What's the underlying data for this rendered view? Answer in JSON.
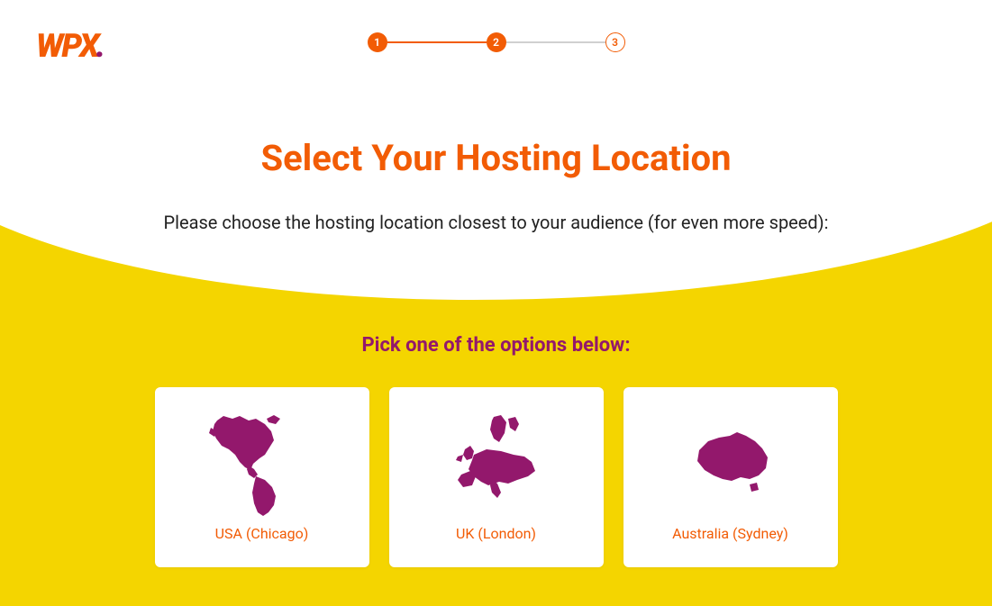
{
  "logo": {
    "text": "WPX",
    "dot": "."
  },
  "stepper": {
    "steps": [
      "1",
      "2",
      "3"
    ],
    "current": 2
  },
  "hero": {
    "title": "Select Your Hosting Location",
    "subtitle": "Please choose the hosting location closest to your audience (for even more speed):"
  },
  "options": {
    "title": "Pick one of the options below:",
    "items": [
      {
        "label": "USA (Chicago)",
        "icon": "americas-map-icon"
      },
      {
        "label": "UK (London)",
        "icon": "europe-map-icon"
      },
      {
        "label": "Australia (Sydney)",
        "icon": "australia-map-icon"
      }
    ]
  },
  "colors": {
    "orange": "#f25c05",
    "magenta": "#93186c",
    "yellow": "#f4d500"
  }
}
